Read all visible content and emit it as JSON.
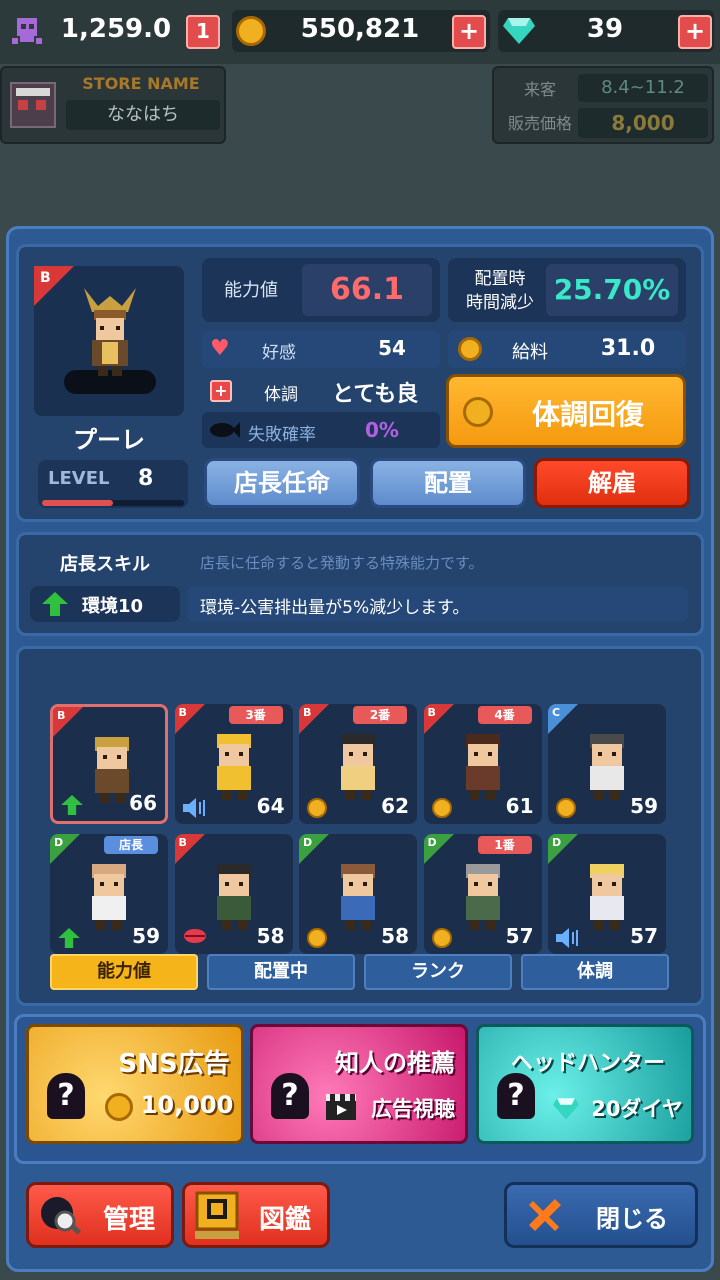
{
  "topbar": {
    "skull_value": "1,259.0",
    "skull_badge": "1",
    "gold_value": "550,821",
    "gem_value": "39"
  },
  "store": {
    "label": "STORE NAME",
    "name": "ななはち"
  },
  "info": {
    "visitors_label": "来客",
    "visitors_value": "8.4~11.2",
    "price_label": "販売価格",
    "price_value": "8,000"
  },
  "employee": {
    "rank": "B",
    "name": "プーレ",
    "level_label": "LEVEL",
    "level_value": "8",
    "level_progress": 0.5,
    "ability_label": "能力値",
    "ability_value": "66.1",
    "deploy_label_1": "配置時",
    "deploy_label_2": "時間減少",
    "deploy_value": "25.70%",
    "affinity_label": "好感",
    "affinity_value": "54",
    "salary_label": "給料",
    "salary_value": "31.0",
    "condition_label": "体調",
    "condition_value": "とても良い",
    "failure_label": "失敗確率",
    "failure_value": "0%",
    "recover_label": "体調回復"
  },
  "actions": {
    "manager": "店長任命",
    "deploy": "配置",
    "fire": "解雇"
  },
  "skill": {
    "title": "店長スキル",
    "desc_hint": "店長に任命すると発動する特殊能力です。",
    "name": "環境10",
    "detail": "環境-公害排出量が5%減少します。"
  },
  "staff": [
    {
      "rank": "B",
      "value": "66",
      "tag": "",
      "icon": "up-arrow-icon",
      "color": "#d83838"
    },
    {
      "rank": "B",
      "value": "64",
      "tag": "3番",
      "icon": "speaker-icon",
      "color": "#d83838"
    },
    {
      "rank": "B",
      "value": "62",
      "tag": "2番",
      "icon": "coin-icon",
      "color": "#d83838"
    },
    {
      "rank": "B",
      "value": "61",
      "tag": "4番",
      "icon": "coin-icon",
      "color": "#d83838"
    },
    {
      "rank": "C",
      "value": "59",
      "tag": "",
      "icon": "coin-icon",
      "color": "#4a90d8"
    },
    {
      "rank": "D",
      "value": "59",
      "tag": "店長",
      "icon": "up-arrow-icon",
      "color": "#3aa040"
    },
    {
      "rank": "B",
      "value": "58",
      "tag": "",
      "icon": "lips-icon",
      "color": "#d83838"
    },
    {
      "rank": "D",
      "value": "58",
      "tag": "",
      "icon": "coin-icon",
      "color": "#3aa040"
    },
    {
      "rank": "D",
      "value": "57",
      "tag": "1番",
      "icon": "coin-icon",
      "color": "#3aa040"
    },
    {
      "rank": "D",
      "value": "57",
      "tag": "",
      "icon": "speaker-icon",
      "color": "#3aa040"
    }
  ],
  "sort_tabs": [
    "能力値",
    "配置中",
    "ランク",
    "体調"
  ],
  "recruit": {
    "sns_title": "SNS広告",
    "sns_cost": "10,000",
    "friend_title": "知人の推薦",
    "friend_cost": "広告視聴",
    "hunter_title": "ヘッドハンター",
    "hunter_cost": "20ダイヤ"
  },
  "bottom": {
    "manage": "管理",
    "book": "図鑑",
    "close": "閉じる"
  }
}
